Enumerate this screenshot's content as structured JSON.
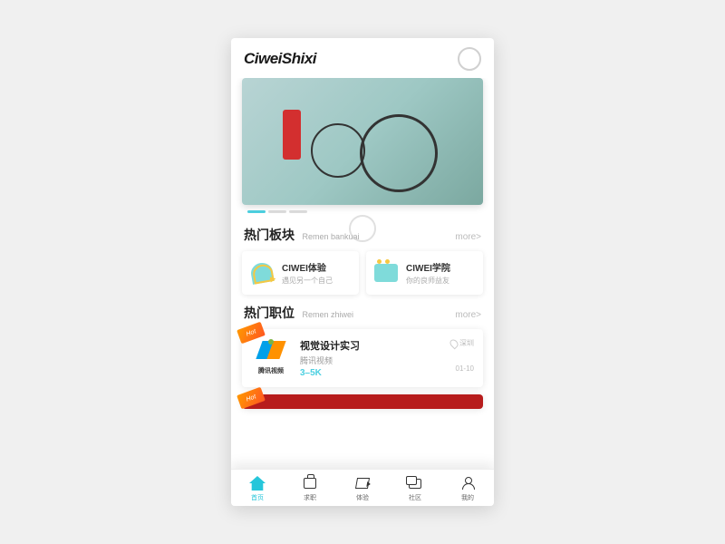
{
  "header": {
    "logo": "CiweiShixi"
  },
  "sections": {
    "bankuai": {
      "title": "热门板块",
      "sub": "Remen bankuai",
      "more": "more>"
    },
    "zhiwei": {
      "title": "热门职位",
      "sub": "Remen zhiwei",
      "more": "more>"
    }
  },
  "cards": {
    "tiyan": {
      "title": "CIWEI体验",
      "desc": "遇见另一个自己"
    },
    "xueyuan": {
      "title": "CIWEI学院",
      "desc": "你的良师益友"
    }
  },
  "jobs": [
    {
      "badge": "Hot",
      "title": "视觉设计实习",
      "company": "腾讯视频",
      "salary": "3–5K",
      "location": "深圳",
      "date": "01-10",
      "logoText": "腾讯视频"
    }
  ],
  "jobs2_badge": "Hot",
  "tabs": {
    "home": "首页",
    "job": "求职",
    "exp": "体验",
    "comm": "社区",
    "mine": "我的"
  }
}
